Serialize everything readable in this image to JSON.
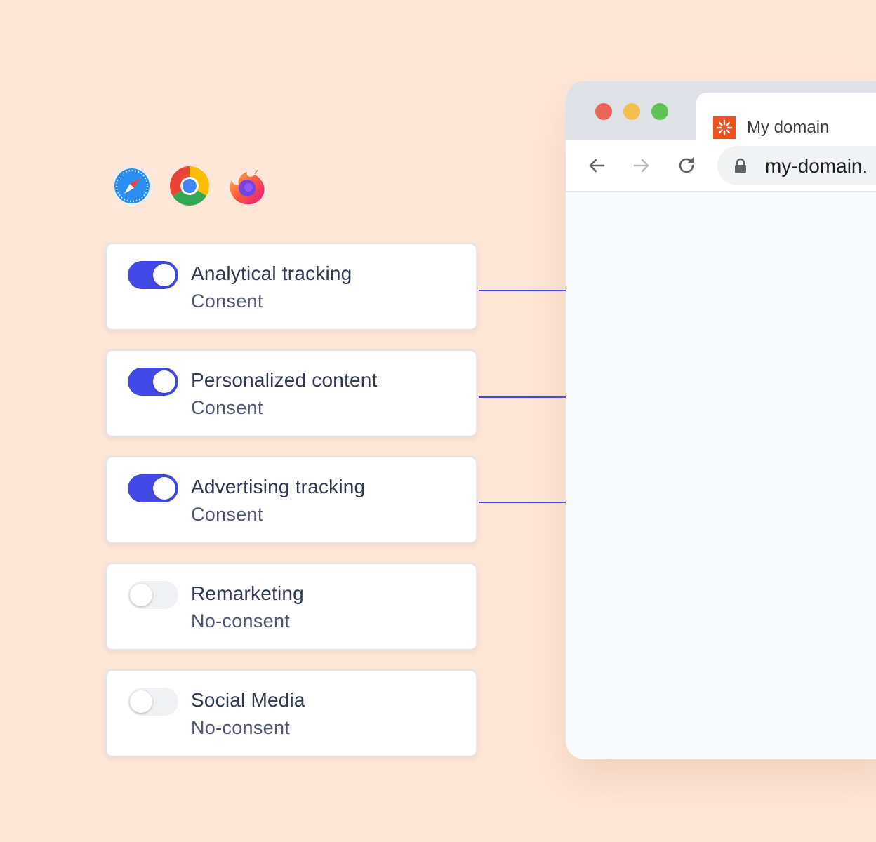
{
  "browsers": [
    {
      "name": "safari-icon"
    },
    {
      "name": "chrome-icon"
    },
    {
      "name": "firefox-icon"
    }
  ],
  "consents": [
    {
      "title": "Analytical tracking",
      "status": "Consent",
      "enabled": true
    },
    {
      "title": "Personalized content",
      "status": "Consent",
      "enabled": true
    },
    {
      "title": "Advertising tracking",
      "status": "Consent",
      "enabled": true
    },
    {
      "title": "Remarketing",
      "status": "No-consent",
      "enabled": false
    },
    {
      "title": "Social Media",
      "status": "No-consent",
      "enabled": false
    }
  ],
  "browser_window": {
    "tab_title": "My domain",
    "url": "my-domain."
  },
  "colors": {
    "background": "#fee6d8",
    "accent": "#4349e6",
    "favicon": "#f0521e"
  }
}
